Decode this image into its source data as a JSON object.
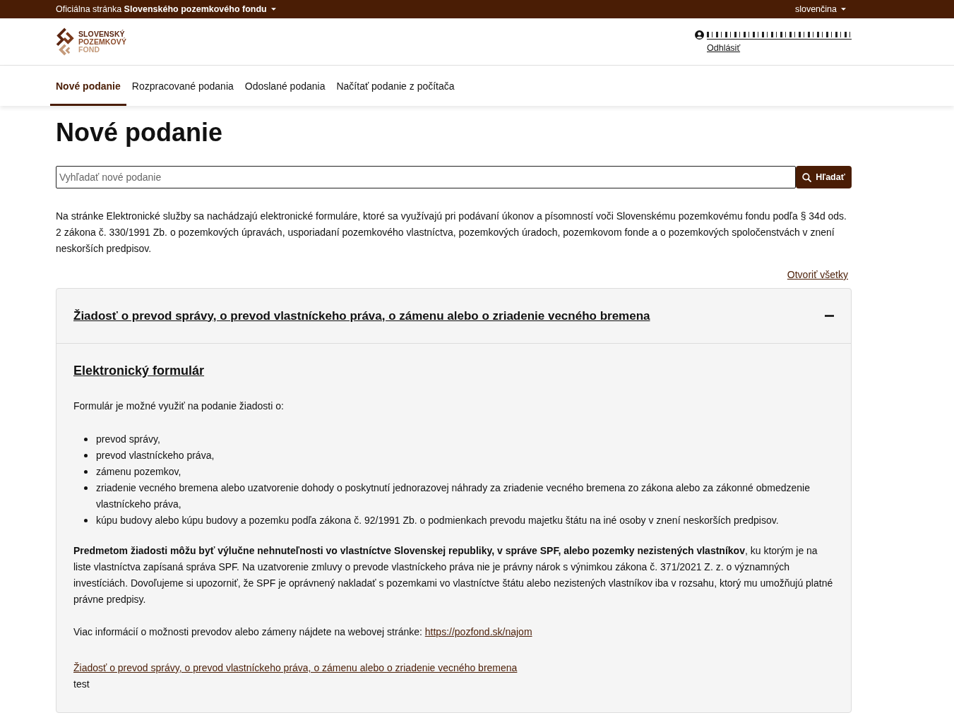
{
  "top_bar": {
    "official_site": "Oficiálna stránka **Slovenského pozemkového fondu**",
    "language": "slovenčina"
  },
  "header": {
    "logo": {
      "lines": [
        "SLOVENSKÝ",
        "POZEMKOVÝ",
        "FOND"
      ]
    },
    "user": {
      "logout": "Odhlásiť"
    }
  },
  "nav": {
    "tabs": [
      {
        "label": "Nové podanie",
        "selected": true
      },
      {
        "label": "Rozpracované podania",
        "selected": false
      },
      {
        "label": "Odoslané podania",
        "selected": false
      },
      {
        "label": "Načítať podanie z počítača",
        "selected": false
      }
    ]
  },
  "page_title": "Nové podanie",
  "search": {
    "placeholder": "Vyhľadať nové podanie",
    "button": "Hľadať"
  },
  "intro": "Na stránke Elektronické služby sa nachádzajú elektronické formuláre, ktoré sa využívajú pri podávaní úkonov a písomností voči Slovenskému pozemkovému fondu podľa § 34d ods. 2 zákona č. 330/1991 Zb. o pozemkových úpravách, usporiadaní pozemkového vlastníctva, pozemkových úradoch, pozemkovom fonde a o pozemkových spoločenstvách v znení neskorších predpisov.",
  "open_all": "Otvoriť všetky",
  "accordion": [
    {
      "title": "Žiadosť o prevod správy, o prevod vlastníckeho práva, o zámenu alebo o zriadenie vecného bremena",
      "expanded": true,
      "body": {
        "heading": "Elektronický formulár",
        "lead": "Formulár je možné využiť na podanie žiadosti o:",
        "list": [
          "prevod správy,",
          "prevod vlastníckeho práva,",
          "zámenu pozemkov,",
          "zriadenie vecného bremena alebo uzatvorenie dohody o poskytnutí jednorazovej náhrady za zriadenie vecného bremena zo zákona alebo za zákonné obmedzenie vlastníckeho práva,",
          "kúpu budovy alebo kúpu budovy a pozemku podľa zákona č. 92/1991 Zb. o podmienkach prevodu majetku štátu na iné osoby v znení neskorších predpisov."
        ],
        "notice": "**Predmetom žiadosti môžu byť výlučne nehnuteľnosti vo vlastníctve Slovenskej republiky, v správe SPF, alebo pozemky nezistených vlastníkov**, ku ktorým je na liste vlastníctva zapísaná správa SPF. Na uzatvorenie zmluvy o prevode vlastníckeho práva nie je právny nárok s výnimkou zákona č. 371/2021 Z. z. o významných investíciách. Dovoľujeme si upozorniť, že SPF je oprávnený nakladať s pozemkami vo vlastníctve štátu alebo nezistených vlastníkov iba v rozsahu, ktorý mu umožňujú platné právne predpisy.",
        "info": {
          "text": "Viac informácií o možnosti prevodov alebo zámeny nájdete na webovej stránke:",
          "link": "https://pozfond.sk/najom"
        },
        "form_link": "Žiadosť o prevod správy, o prevod vlastníckeho práva, o zámenu alebo o zriadenie vecného bremena",
        "note": "test"
      }
    }
  ]
}
